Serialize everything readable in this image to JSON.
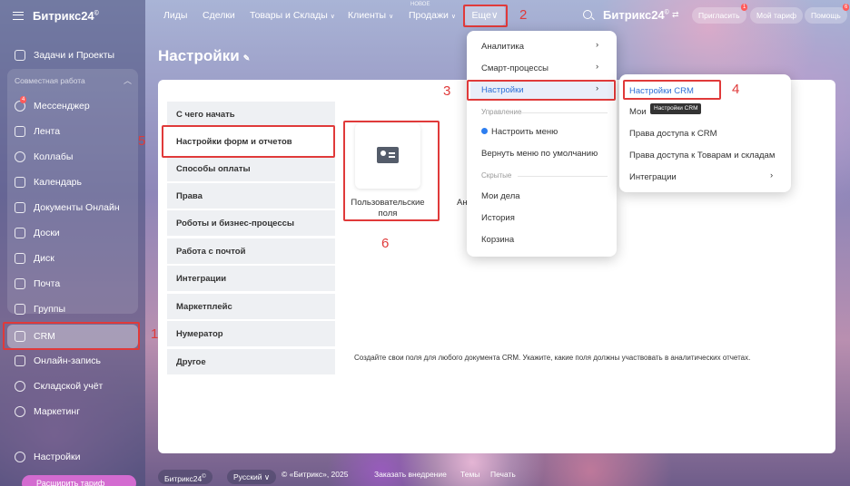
{
  "app": {
    "logo": "Битрикс24",
    "logo_mark": "©"
  },
  "sidebar": {
    "section_label": "Совместная работа",
    "items": [
      {
        "label": "Задачи и Проекты"
      },
      {
        "label": "Мессенджер",
        "badge": "4"
      },
      {
        "label": "Лента"
      },
      {
        "label": "Коллабы"
      },
      {
        "label": "Календарь"
      },
      {
        "label": "Документы Онлайн"
      },
      {
        "label": "Доски"
      },
      {
        "label": "Диск"
      },
      {
        "label": "Почта"
      },
      {
        "label": "Группы"
      },
      {
        "label": "CRM"
      },
      {
        "label": "Онлайн-запись"
      },
      {
        "label": "Складской учёт"
      },
      {
        "label": "Маркетинг"
      },
      {
        "label": "Настройки"
      }
    ],
    "tariff_button": "Расширить тариф"
  },
  "topnav": {
    "items": [
      "Лиды",
      "Сделки",
      "Товары и Склады",
      "Клиенты",
      "Продажи"
    ],
    "new_label": "НОВОЕ",
    "more_label": "Еще",
    "brand": "Битрикс24",
    "invite_label": "Пригласить",
    "invite_badge": "1",
    "tariff_label": "Мой тариф",
    "help_label": "Помощь",
    "help_badge": "6"
  },
  "page": {
    "title": "Настройки",
    "tabs": [
      "С чего начать",
      "Настройки форм и отчетов",
      "Способы оплаты",
      "Права",
      "Роботы и бизнес-процессы",
      "Работа с почтой",
      "Интеграции",
      "Маркетплейс",
      "Нумератор",
      "Другое"
    ],
    "card_label": "Пользовательские поля",
    "card2_label": "Ан",
    "description": "Создайте свои поля для любого документа CRM. Укажите, какие поля должны участвовать в аналитических отчетах."
  },
  "more_menu": {
    "items_top": [
      "Аналитика",
      "Смарт-процессы",
      "Настройки"
    ],
    "caption_manage": "Управление",
    "configure_menu": "Настроить меню",
    "reset_menu": "Вернуть меню по умолчанию",
    "caption_hidden": "Скрытые",
    "hidden_items": [
      "Мои дела",
      "История",
      "Корзина"
    ]
  },
  "sub_menu": {
    "items": [
      "Настройки CRM",
      "Мои",
      "Права доступа к CRM",
      "Права доступа к Товарам и складам",
      "Интеграции"
    ],
    "tooltip": "Настройки CRM"
  },
  "annotations": [
    "1",
    "2",
    "3",
    "4",
    "5",
    "6"
  ],
  "footer": {
    "brand": "Битрикс24",
    "language": "Русский",
    "copyright": "© «Битрикс», 2025",
    "order": "Заказать внедрение",
    "themes": "Темы",
    "print": "Печать"
  },
  "colors": {
    "annotation_red": "#e03a3a",
    "link_blue": "#2d7ef0",
    "tariff_pink": "#d36bd0"
  }
}
